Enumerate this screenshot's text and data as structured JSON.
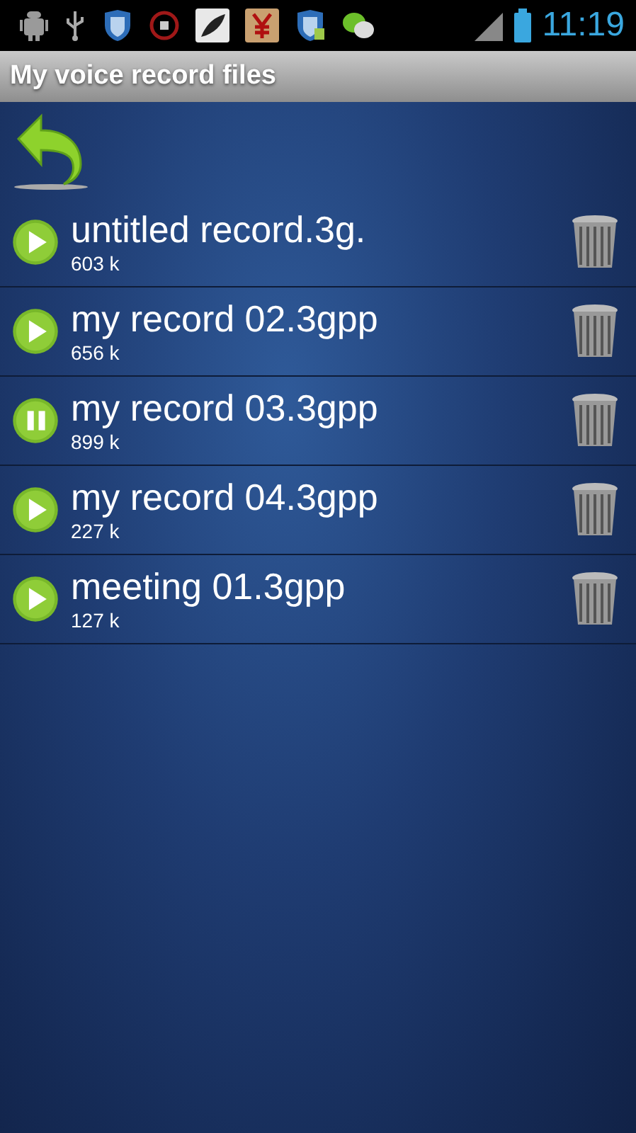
{
  "status_bar": {
    "time": "11:19"
  },
  "title_bar": {
    "title": "My voice record files"
  },
  "files": [
    {
      "name": "untitled record.3g.",
      "size": "603 k",
      "playing": false
    },
    {
      "name": "my record 02.3gpp",
      "size": "656 k",
      "playing": false
    },
    {
      "name": "my record 03.3gpp",
      "size": "899 k",
      "playing": true
    },
    {
      "name": "my record 04.3gpp",
      "size": "227 k",
      "playing": false
    },
    {
      "name": "meeting 01.3gpp",
      "size": "127 k",
      "playing": false
    }
  ]
}
